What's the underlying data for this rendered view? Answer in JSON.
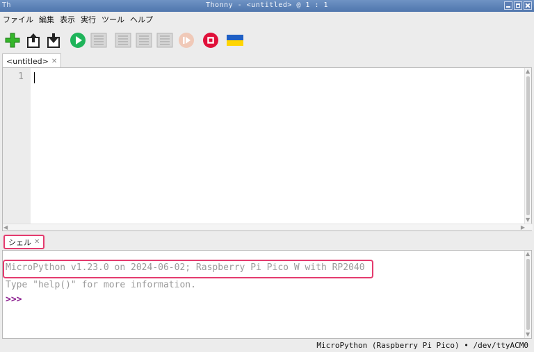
{
  "window": {
    "title": "Thonny  -  <untitled>  @  1 : 1"
  },
  "menu": [
    "ファイル",
    "編集",
    "表示",
    "実行",
    "ツール",
    "ヘルプ"
  ],
  "toolbar": {
    "icons": [
      "new-file-icon",
      "open-file-icon",
      "save-file-icon",
      "run-icon",
      "debug-icon",
      "step-over-icon",
      "step-into-icon",
      "step-out-icon",
      "resume-icon",
      "stop-icon",
      "ukraine-flag-icon"
    ]
  },
  "editor": {
    "tab_label": "<untitled>",
    "line_number": "1"
  },
  "shell": {
    "tab_label": "シェル",
    "lines": [
      "MicroPython v1.23.0 on 2024-06-02; Raspberry Pi Pico W with RP2040",
      "Type \"help()\" for more information.",
      ">>>"
    ]
  },
  "status": {
    "text": "MicroPython (Raspberry Pi Pico)  •  /dev/ttyACM0"
  },
  "colors": {
    "titlebar": "#5a80b8",
    "highlight": "#e43b6e",
    "prompt": "#8b1e8f",
    "run": "#1fb45a",
    "stop": "#e0103a",
    "new": "#34b52a"
  }
}
